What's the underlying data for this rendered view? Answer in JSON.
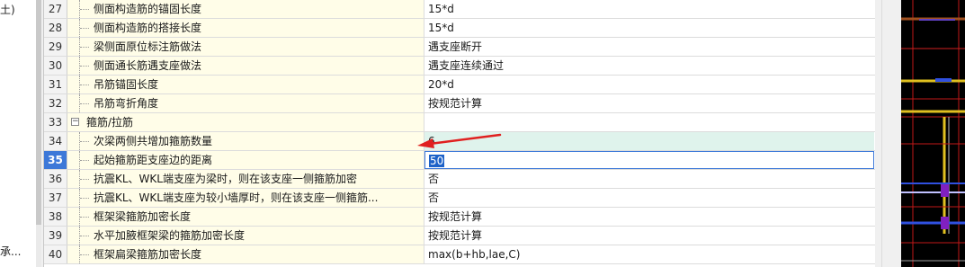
{
  "left_panel": {
    "texts": [
      {
        "text": "土)"
      },
      {
        "text": "承..."
      }
    ]
  },
  "rows": [
    {
      "num": "27",
      "name": "侧面构造筋的锚固长度",
      "value": "15*d"
    },
    {
      "num": "28",
      "name": "侧面构造筋的搭接长度",
      "value": "15*d"
    },
    {
      "num": "29",
      "name": "梁侧面原位标注筋做法",
      "value": "遇支座断开"
    },
    {
      "num": "30",
      "name": "侧面通长筋遇支座做法",
      "value": "遇支座连续通过"
    },
    {
      "num": "31",
      "name": "吊筋锚固长度",
      "value": "20*d"
    },
    {
      "num": "32",
      "name": "吊筋弯折角度",
      "value": "按规范计算"
    },
    {
      "num": "33",
      "name": "箍筋/拉筋",
      "value": "",
      "group": true,
      "toggle": "−"
    },
    {
      "num": "34",
      "name": "次梁两侧共增加箍筋数量",
      "value": "6",
      "highlight": true
    },
    {
      "num": "35",
      "name": "起始箍筋距支座边的距离",
      "value": "50",
      "selected": true
    },
    {
      "num": "36",
      "name": "抗震KL、WKL端支座为梁时，则在该支座一侧箍筋加密",
      "value": "否"
    },
    {
      "num": "37",
      "name": "抗震KL、WKL端支座为较小墙厚时，则在该支座一侧箍筋...",
      "value": "否"
    },
    {
      "num": "38",
      "name": "框架梁箍筋加密长度",
      "value": "按规范计算"
    },
    {
      "num": "39",
      "name": "水平加腋框架梁的箍筋加密长度",
      "value": "按规范计算"
    },
    {
      "num": "40",
      "name": "框架扁梁箍筋加密长度",
      "value": "max(b+hb,lae,C)"
    }
  ],
  "annotation": {
    "color": "#e02020",
    "points_to_row": "34"
  },
  "colors": {
    "selected_accent": "#3c78d8",
    "highlight_row": "#dff3ec",
    "name_cell_bg": "#fffde8",
    "cad_bg": "#000000"
  }
}
